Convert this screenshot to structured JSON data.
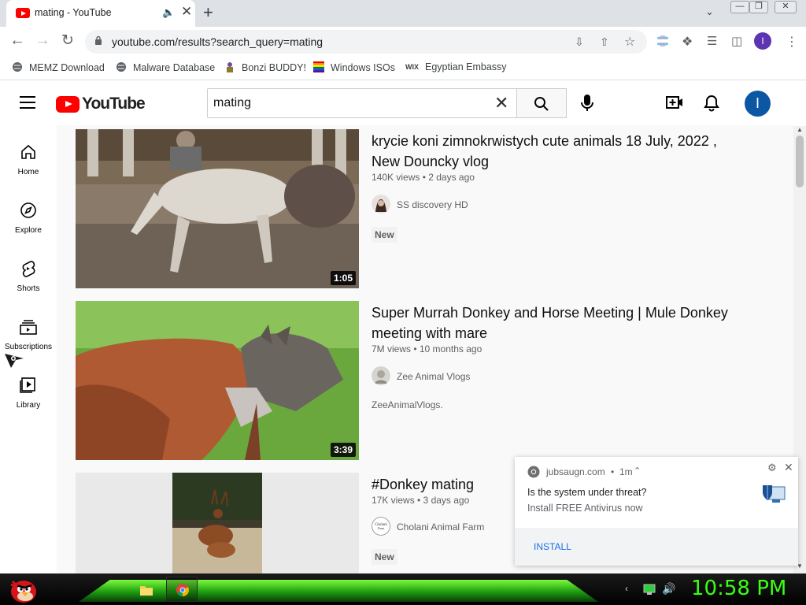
{
  "browser": {
    "tab_title": "mating - YouTube",
    "url": "youtube.com/results?search_query=mating",
    "bookmarks": [
      {
        "label": "MEMZ Download",
        "icon": "globe-icon"
      },
      {
        "label": "Malware Database",
        "icon": "globe-icon"
      },
      {
        "label": "Bonzi BUDDY!",
        "icon": "bonzi-icon"
      },
      {
        "label": "Windows ISOs",
        "icon": "windows-flag-icon"
      },
      {
        "label": "Egyptian Embassy",
        "icon": "wix-icon"
      }
    ],
    "profile_initial": "I"
  },
  "youtube": {
    "logo_text": "YouTube",
    "search_query": "mating",
    "avatar_initial": "I",
    "guide": [
      {
        "label": "Home",
        "icon": "home-icon"
      },
      {
        "label": "Explore",
        "icon": "compass-icon"
      },
      {
        "label": "Shorts",
        "icon": "shorts-icon"
      },
      {
        "label": "Subscriptions",
        "icon": "subscriptions-icon"
      },
      {
        "label": "Library",
        "icon": "library-icon"
      }
    ],
    "results": [
      {
        "title": "krycie koni zimnokrwistych cute animals 18 July, 2022 , New Douncky vlog",
        "meta": "140K views • 2 days ago",
        "channel": "SS discovery HD",
        "badge": "New",
        "duration": "1:05"
      },
      {
        "title": "Super Murrah Donkey and Horse Meeting | Mule Donkey meeting with mare",
        "meta": "7M views • 10 months ago",
        "channel": "Zee Animal Vlogs",
        "description": "ZeeAnimalVlogs.",
        "duration": "3:39"
      },
      {
        "title": "#Donkey mating",
        "meta": "17K views • 3 days ago",
        "channel": "Cholani Animal Farm",
        "badge": "New"
      }
    ]
  },
  "notification": {
    "site": "jubsaugn.com",
    "time": "1m",
    "title": "Is the system under threat?",
    "body": "Install FREE Antivirus now",
    "action": "INSTALL"
  },
  "taskbar": {
    "clock": "10:58 PM"
  },
  "colors": {
    "youtube_red": "#ff0000",
    "link_blue": "#1a73e8",
    "clock_green": "#39ff14"
  }
}
